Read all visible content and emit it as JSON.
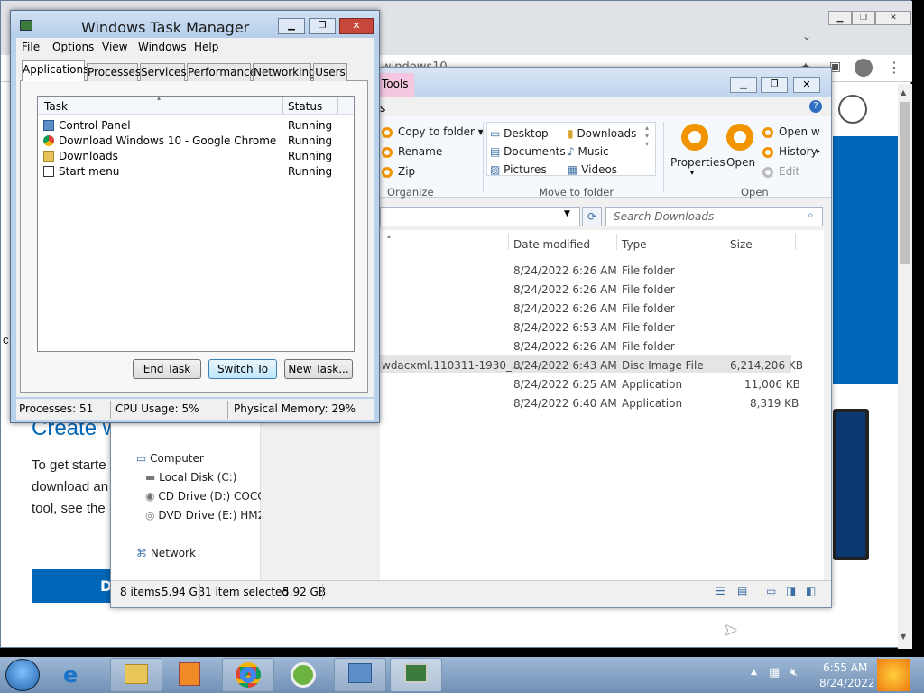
{
  "chrome": {
    "url_fragment": "windows10",
    "page_heading": "Create w",
    "paragraph_lines": [
      "To get starte",
      "download an",
      "tool, see the"
    ],
    "side_char": "c",
    "blue_button_text": "D"
  },
  "explorer": {
    "ribbon_tab": "Tools",
    "ribbon_tab_fragment": "s",
    "organize": {
      "items": [
        "Copy to folder",
        "Rename",
        "Zip"
      ],
      "label": "Organize"
    },
    "move_to_folder": {
      "items": [
        "Desktop",
        "Downloads",
        "Documents",
        "Music",
        "Pictures",
        "Videos"
      ],
      "label": "Move to folder"
    },
    "open_group": {
      "properties": "Properties",
      "open": "Open",
      "open_with": "Open w",
      "history": "History",
      "edit": "Edit",
      "label": "Open"
    },
    "search_placeholder": "Search Downloads",
    "columns": [
      "Date modified",
      "Type",
      "Size"
    ],
    "rows": [
      {
        "name": "",
        "date": "8/24/2022 6:26 AM",
        "type": "File folder",
        "size": ""
      },
      {
        "name": "",
        "date": "8/24/2022 6:26 AM",
        "type": "File folder",
        "size": ""
      },
      {
        "name": "",
        "date": "8/24/2022 6:26 AM",
        "type": "File folder",
        "size": ""
      },
      {
        "name": "",
        "date": "8/24/2022 6:53 AM",
        "type": "File folder",
        "size": ""
      },
      {
        "name": "",
        "date": "8/24/2022 6:26 AM",
        "type": "File folder",
        "size": ""
      },
      {
        "name": "wdacxml.110311-1930_...",
        "date": "8/24/2022 6:43 AM",
        "type": "Disc Image File",
        "size": "6,214,206 KB"
      },
      {
        "name": "",
        "date": "8/24/2022 6:25 AM",
        "type": "Application",
        "size": "11,006 KB"
      },
      {
        "name": "",
        "date": "8/24/2022 6:40 AM",
        "type": "Application",
        "size": "8,319 KB"
      }
    ],
    "nav": {
      "computer": "Computer",
      "drives": [
        "Local Disk (C:)",
        "CD Drive (D:) COCC",
        "DVD Drive (E:) HM2_"
      ],
      "network": "Network"
    },
    "status": {
      "items": "8 items",
      "size": "5.94 GB",
      "selected": "1 item selected",
      "selected_size": "5.92 GB"
    }
  },
  "task_manager": {
    "title": "Windows Task Manager",
    "menu": [
      "File",
      "Options",
      "View",
      "Windows",
      "Help"
    ],
    "tabs": [
      "Applications",
      "Processes",
      "Services",
      "Performance",
      "Networking",
      "Users"
    ],
    "col_task": "Task",
    "col_status": "Status",
    "tasks": [
      {
        "name": "Control Panel",
        "status": "Running"
      },
      {
        "name": "Download Windows 10 - Google Chrome",
        "status": "Running"
      },
      {
        "name": "Downloads",
        "status": "Running"
      },
      {
        "name": "Start menu",
        "status": "Running"
      }
    ],
    "buttons": {
      "end": "End Task",
      "switch": "Switch To",
      "new": "New Task..."
    },
    "status": {
      "processes": "Processes: 51",
      "cpu": "CPU Usage: 5%",
      "memory": "Physical Memory: 29%"
    }
  },
  "taskbar": {
    "time": "6:55 AM",
    "date": "8/24/2022"
  },
  "colors": {
    "accent_blue": "#0067b8",
    "explorer_orange": "#f29400",
    "taskbar": "#7f9dc2"
  }
}
